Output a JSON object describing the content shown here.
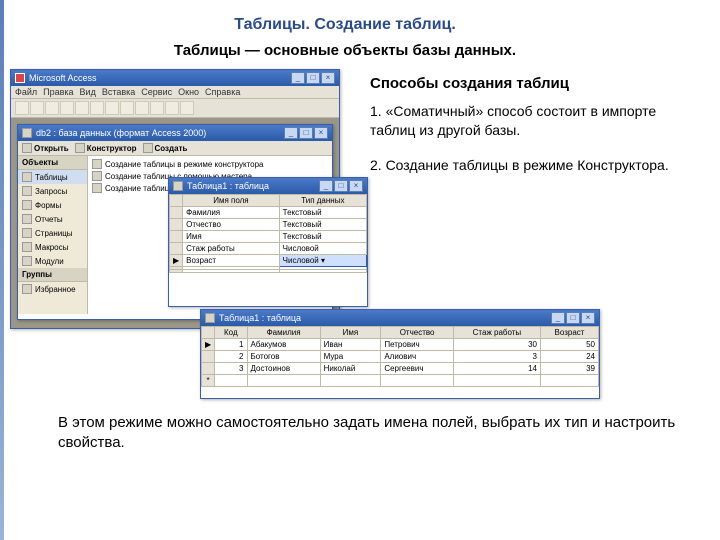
{
  "title": "Таблицы. Создание таблиц.",
  "subtitle": "Таблицы — основные объекты базы данных.",
  "methods_heading": "Способы создания таблиц",
  "para1": "1. «Соматичный» способ состоит в импорте таблиц из другой базы.",
  "para2": "2.  Создание таблицы в режиме Конструктора.",
  "bottom": "В этом режиме можно самостоятельно задать имена полей, выбрать их тип и  настроить свойства.",
  "access": {
    "app_title": "Microsoft Access",
    "menus": [
      "Файл",
      "Правка",
      "Вид",
      "Вставка",
      "Сервис",
      "Окно",
      "Справка"
    ],
    "db_title": "db2 : база данных (формат Access 2000)",
    "db_toolbar": {
      "open": "Открыть",
      "design": "Конструктор",
      "create": "Создать"
    },
    "side_header": "Объекты",
    "side_items": [
      "Таблицы",
      "Запросы",
      "Формы",
      "Отчеты",
      "Страницы",
      "Макросы",
      "Модули"
    ],
    "side_groups": "Группы",
    "side_fav": "Избранное",
    "create_options": [
      "Создание таблицы в режиме конструктора",
      "Создание таблицы с помощью мастера",
      "Создание таблицы путём ввода данных"
    ]
  },
  "design": {
    "title": "Таблица1 : таблица",
    "col_name": "Имя поля",
    "col_type": "Тип данных",
    "rows": [
      {
        "name": "Фамилия",
        "type": "Текстовый"
      },
      {
        "name": "Отчество",
        "type": "Текстовый"
      },
      {
        "name": "Имя",
        "type": "Текстовый"
      },
      {
        "name": "Стаж работы",
        "type": "Числовой"
      },
      {
        "name": "Возраст",
        "type": "Числовой"
      }
    ]
  },
  "datasheet": {
    "title": "Таблица1 : таблица",
    "headers": [
      "Код",
      "Фамилия",
      "Имя",
      "Отчество",
      "Стаж работы",
      "Возраст"
    ],
    "rows": [
      [
        "1",
        "Абакумов",
        "Иван",
        "Петрович",
        "30",
        "50"
      ],
      [
        "2",
        "Ботогов",
        "Мура",
        "Алиович",
        "3",
        "24"
      ],
      [
        "3",
        "Достоинов",
        "Николай",
        "Сергеевич",
        "14",
        "39"
      ]
    ]
  }
}
